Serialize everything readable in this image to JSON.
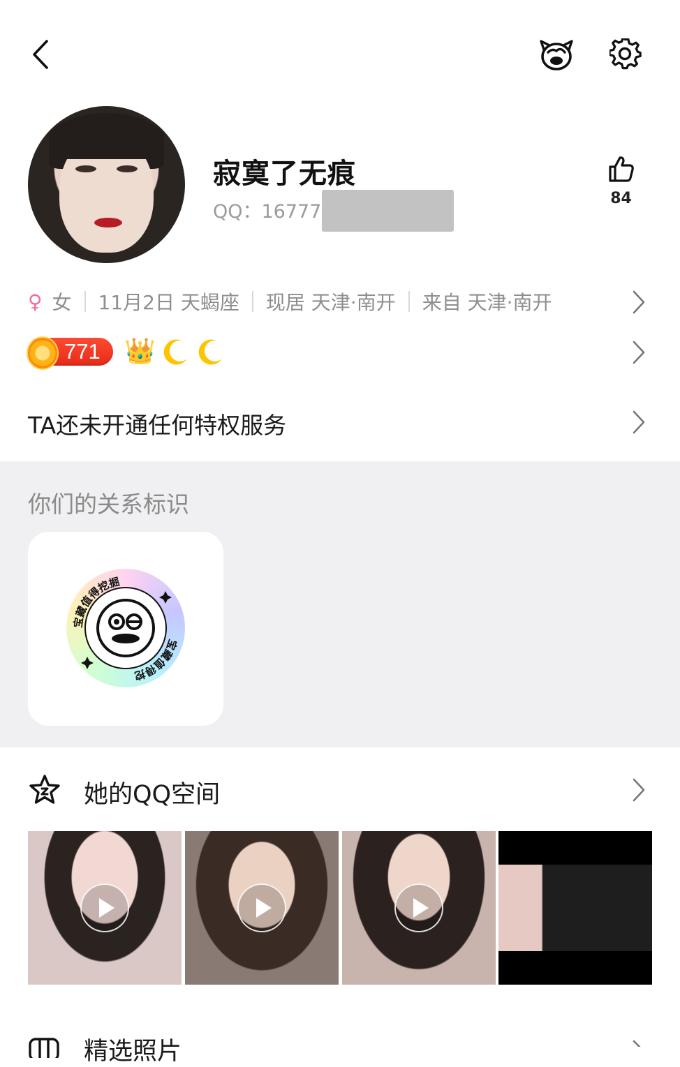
{
  "topbar": {
    "back_icon": "chevron-left-icon",
    "pet_icon": "cartoon-face-icon",
    "settings_icon": "gear-icon"
  },
  "profile": {
    "nickname": "寂寞了无痕",
    "qq_label": "QQ：16777",
    "likes": "84"
  },
  "info": {
    "gender_symbol": "♀",
    "gender": "女",
    "birthday": "11月2日 天蝎座",
    "residence": "现居 天津·南开",
    "hometown": "来自 天津·南开"
  },
  "badges": {
    "level": "771",
    "crown": "👑",
    "moon1": "🌙",
    "moon2": "🌙"
  },
  "privilege": {
    "text": "TA还未开通任何特权服务"
  },
  "relation": {
    "title": "你们的关系标识",
    "badge_text": "宝藏值得挖掘"
  },
  "qzone": {
    "title": "她的QQ空间",
    "thumbnails": [
      {
        "type": "video"
      },
      {
        "type": "video"
      },
      {
        "type": "video"
      },
      {
        "type": "image"
      }
    ]
  },
  "next_section": {
    "title": "精选照片"
  },
  "colors": {
    "accent_female": "#f06aa0",
    "level_red": "#e62b18",
    "section_bg": "#f0f0f2"
  }
}
